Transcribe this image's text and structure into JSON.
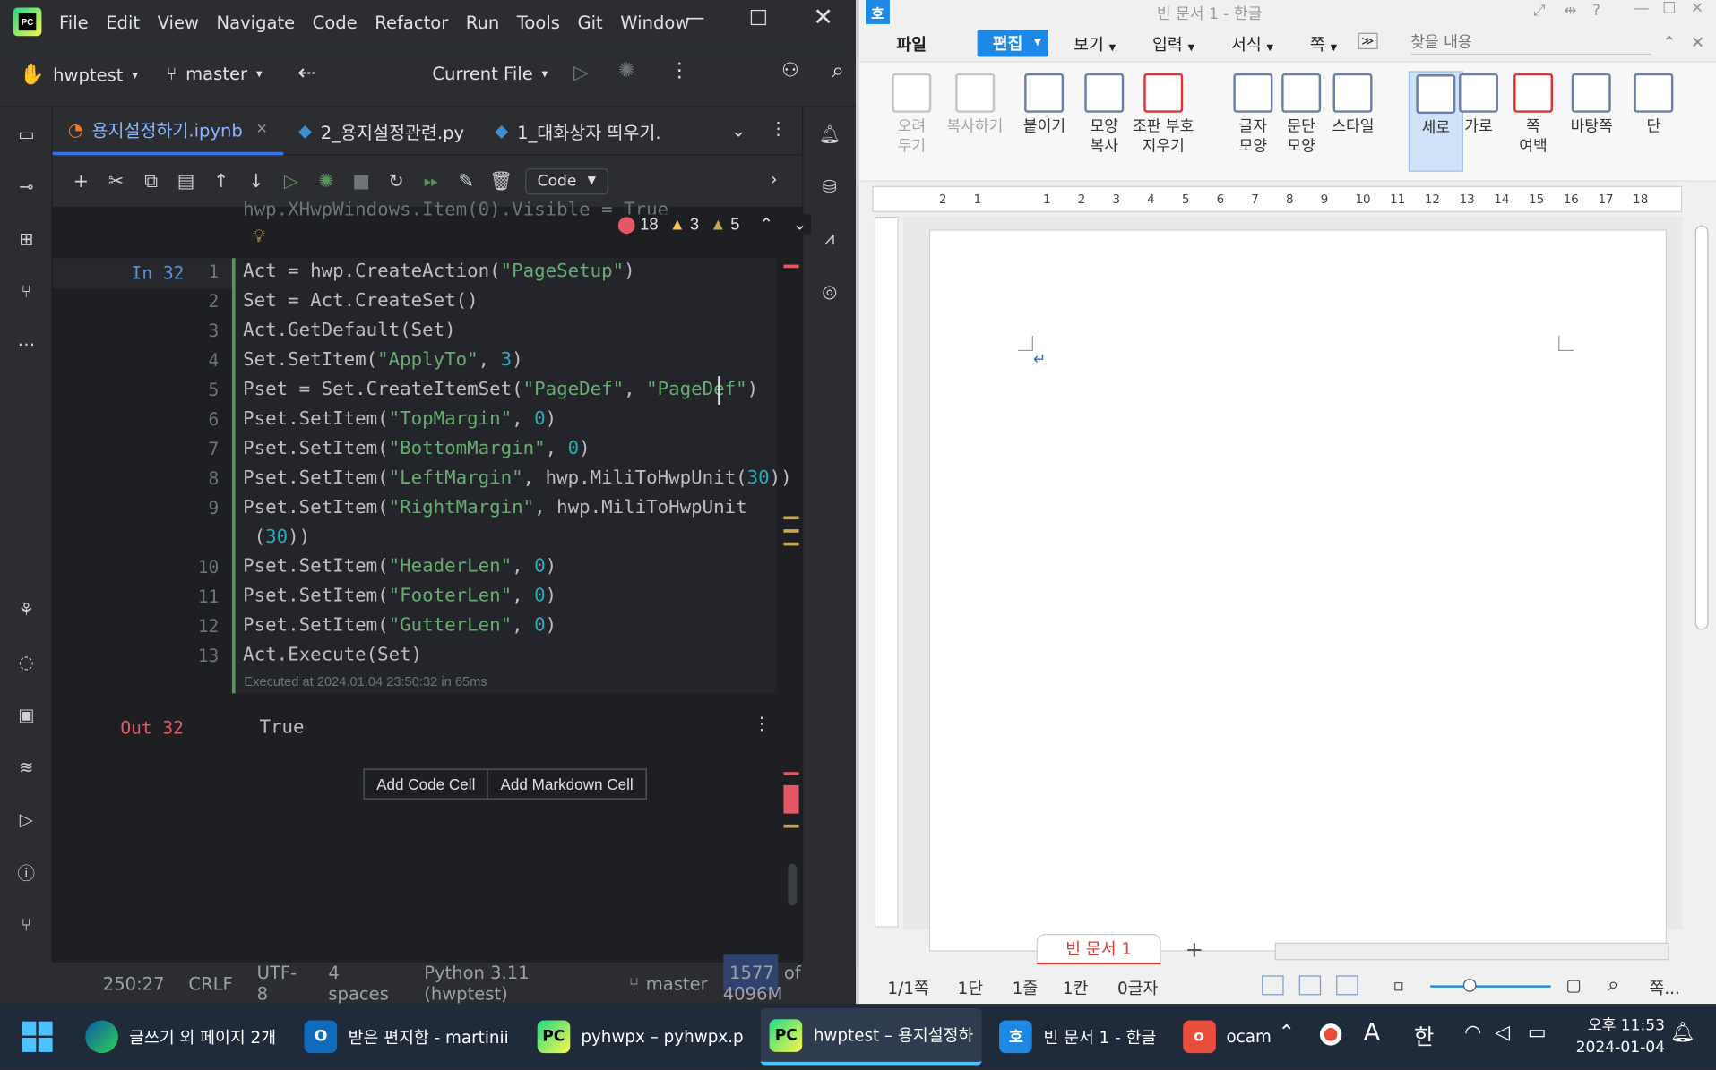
{
  "pycharm": {
    "menu": [
      "File",
      "Edit",
      "View",
      "Navigate",
      "Code",
      "Refactor",
      "Run",
      "Tools",
      "Git",
      "Window"
    ],
    "project": "hwptest",
    "branch": "master",
    "run_config": "Current File",
    "tabs": [
      {
        "label": "용지설정하기.ipynb",
        "active": true
      },
      {
        "label": "2_용지설정관련.py"
      },
      {
        "label": "1_대화상자 띄우기."
      }
    ],
    "cell_type": "Code",
    "prev_line": "hwp.XHwpWindows.Item(0).Visible = True",
    "inspections": {
      "errors": "18",
      "warnings": "3",
      "weak": "5"
    },
    "cell_in": "In 32",
    "cell_out": "Out 32",
    "output": "True",
    "executed": "Executed at 2024.01.04 23:50:32 in 65ms",
    "buttons": {
      "add_code": "Add Code Cell",
      "add_md": "Add Markdown Cell"
    },
    "status": {
      "pos": "250:27",
      "eol": "CRLF",
      "enc": "UTF-8",
      "indent": "4 spaces",
      "interp": "Python 3.11 (hwptest)",
      "branch": "master",
      "mem_used": "1577",
      "mem_total": "of 4096M"
    }
  },
  "hwp": {
    "title": "빈 문서 1 - 한글",
    "menu": [
      "파일",
      "편집",
      "보기",
      "입력",
      "서식",
      "쪽"
    ],
    "search_placeholder": "찾을 내용",
    "ribbon": [
      "오려\n두기",
      "복사하기",
      "붙이기",
      "모양\n복사",
      "조판 부호\n지우기",
      "글자\n모양",
      "문단\n모양",
      "스타일",
      "세로",
      "가로",
      "쪽\n여백",
      "바탕쪽",
      "단"
    ],
    "doc_tab": "빈 문서 1",
    "status": [
      "1/1쪽",
      "1단",
      "1줄",
      "1칸",
      "0글자"
    ],
    "zoom_label": "쪽..."
  },
  "taskbar": {
    "items": [
      "글쓰기 외 페이지 2개",
      "받은 편지함 - martinii",
      "pyhwpx – pyhwpx.p",
      "hwptest – 용지설정하",
      "빈 문서 1 - 한글",
      "ocam"
    ],
    "ime": "한",
    "time": "오후 11:53",
    "date": "2024-01-04"
  },
  "colors": {
    "accent": "#3574f0",
    "error": "#e55765",
    "hwp_accent": "#1e88e5"
  }
}
